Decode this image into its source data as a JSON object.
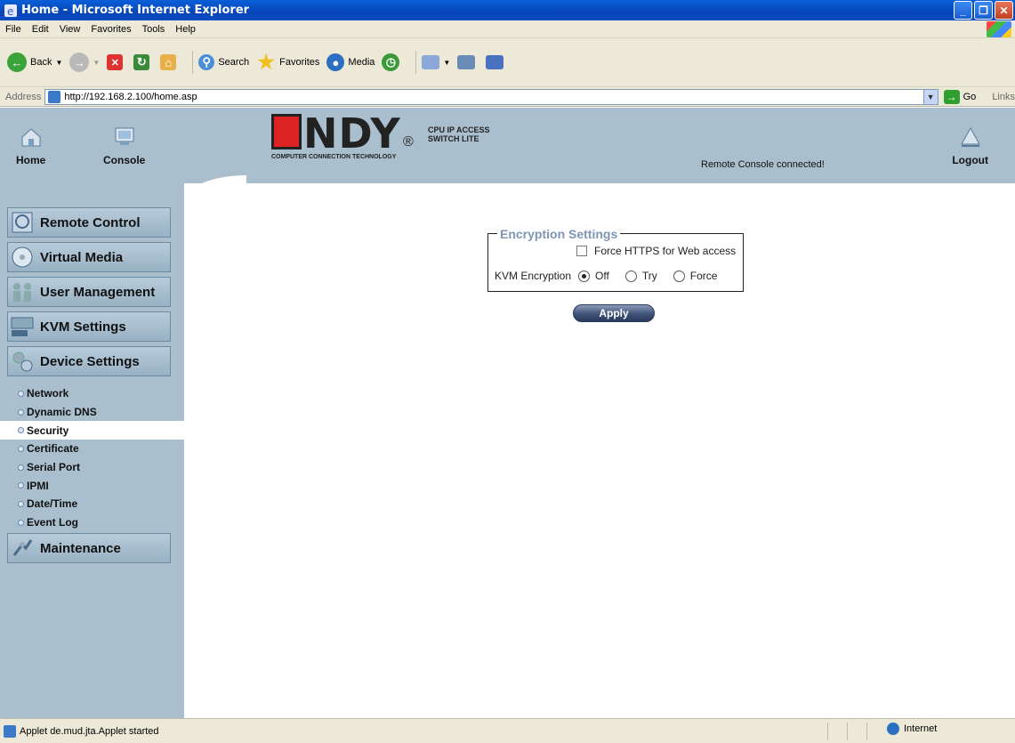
{
  "window": {
    "title": "Home - Microsoft Internet Explorer",
    "minimize": "_",
    "maximize": "❐",
    "close": "✕"
  },
  "menubar": [
    "File",
    "Edit",
    "View",
    "Favorites",
    "Tools",
    "Help"
  ],
  "toolbar": {
    "back": "Back",
    "search": "Search",
    "favorites": "Favorites",
    "media": "Media"
  },
  "address": {
    "label": "Address",
    "url": "http://192.168.2.100/home.asp",
    "go": "Go",
    "links": "Links"
  },
  "header": {
    "home": "Home",
    "console": "Console",
    "logout": "Logout",
    "status": "Remote Console connected!",
    "logo_brand": "NDY",
    "logo_tagline": "COMPUTER CONNECTION TECHNOLOGY",
    "logo_product_1": "CPU IP ACCESS",
    "logo_product_2": "SWITCH LITE",
    "logo_reg": "®"
  },
  "sidebar": {
    "menus": [
      {
        "label": "Remote Control",
        "icon": "monitor-icon"
      },
      {
        "label": "Virtual Media",
        "icon": "disc-icon"
      },
      {
        "label": "User Management",
        "icon": "users-icon"
      },
      {
        "label": "KVM Settings",
        "icon": "keyboard-icon"
      },
      {
        "label": "Device Settings",
        "icon": "gears-icon"
      }
    ],
    "sub_items": [
      "Network",
      "Dynamic DNS",
      "Security",
      "Certificate",
      "Serial Port",
      "IPMI",
      "Date/Time",
      "Event Log"
    ],
    "active_sub": "Security",
    "maintenance": "Maintenance"
  },
  "encryption": {
    "legend": "Encryption Settings",
    "force_https_label": "Force HTTPS for Web access",
    "force_https_checked": false,
    "kvm_label": "KVM Encryption",
    "options": [
      "Off",
      "Try",
      "Force"
    ],
    "selected": "Off",
    "apply": "Apply"
  },
  "statusbar": {
    "text": "Applet de.mud.jta.Applet started",
    "zone": "Internet"
  },
  "colors": {
    "header_bg": "#aabfce",
    "legend": "#7f95b5",
    "titlebar": "#0a5fd8"
  }
}
